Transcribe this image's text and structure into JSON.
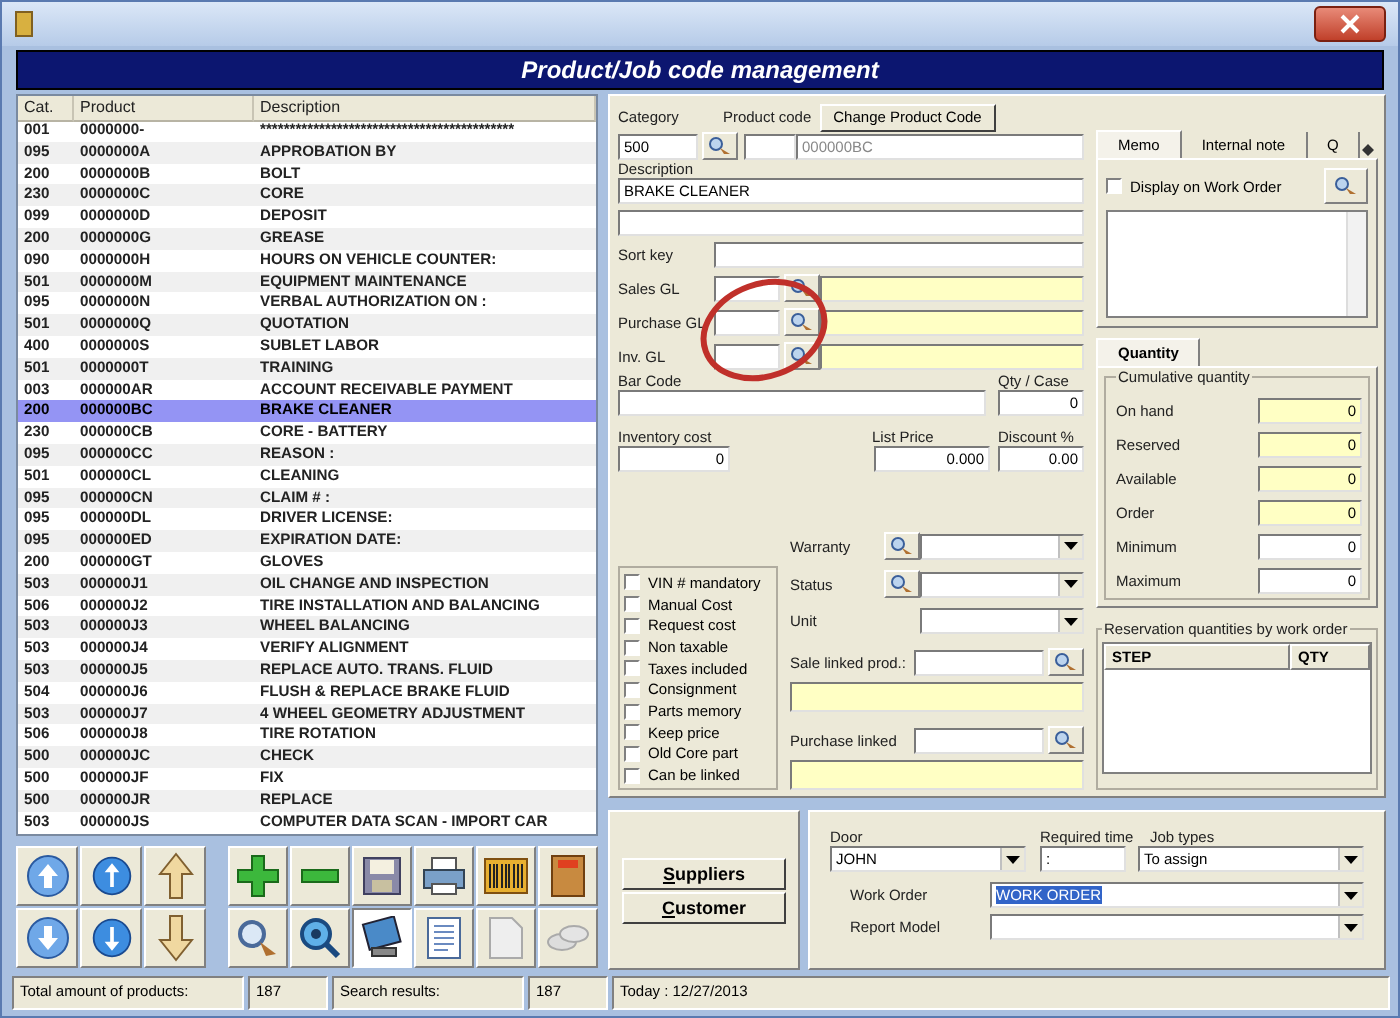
{
  "window": {
    "title": "Product/Job code management"
  },
  "products": {
    "columns": [
      "Cat.",
      "Product",
      "Description"
    ],
    "rows": [
      {
        "cat": "001",
        "product": "0000000-",
        "description": "*******************************************",
        "selected": false
      },
      {
        "cat": "095",
        "product": "0000000A",
        "description": "APPROBATION BY",
        "selected": false
      },
      {
        "cat": "200",
        "product": "0000000B",
        "description": "BOLT",
        "selected": false
      },
      {
        "cat": "230",
        "product": "0000000C",
        "description": "CORE",
        "selected": false
      },
      {
        "cat": "099",
        "product": "0000000D",
        "description": "DEPOSIT",
        "selected": false
      },
      {
        "cat": "200",
        "product": "0000000G",
        "description": "GREASE",
        "selected": false
      },
      {
        "cat": "090",
        "product": "0000000H",
        "description": "HOURS ON VEHICLE COUNTER:",
        "selected": false
      },
      {
        "cat": "501",
        "product": "0000000M",
        "description": "EQUIPMENT MAINTENANCE",
        "selected": false
      },
      {
        "cat": "095",
        "product": "0000000N",
        "description": "VERBAL AUTHORIZATION ON :",
        "selected": false
      },
      {
        "cat": "501",
        "product": "0000000Q",
        "description": "QUOTATION",
        "selected": false
      },
      {
        "cat": "400",
        "product": "0000000S",
        "description": "SUBLET LABOR",
        "selected": false
      },
      {
        "cat": "501",
        "product": "0000000T",
        "description": "TRAINING",
        "selected": false
      },
      {
        "cat": "003",
        "product": "000000AR",
        "description": "ACCOUNT RECEIVABLE PAYMENT",
        "selected": false
      },
      {
        "cat": "200",
        "product": "000000BC",
        "description": "BRAKE CLEANER",
        "selected": true
      },
      {
        "cat": "230",
        "product": "000000CB",
        "description": "CORE - BATTERY",
        "selected": false
      },
      {
        "cat": "095",
        "product": "000000CC",
        "description": "REASON :",
        "selected": false
      },
      {
        "cat": "501",
        "product": "000000CL",
        "description": "CLEANING",
        "selected": false
      },
      {
        "cat": "095",
        "product": "000000CN",
        "description": "CLAIM # :",
        "selected": false
      },
      {
        "cat": "095",
        "product": "000000DL",
        "description": "DRIVER LICENSE:",
        "selected": false
      },
      {
        "cat": "095",
        "product": "000000ED",
        "description": "EXPIRATION DATE:",
        "selected": false
      },
      {
        "cat": "200",
        "product": "000000GT",
        "description": "GLOVES",
        "selected": false
      },
      {
        "cat": "503",
        "product": "000000J1",
        "description": "OIL CHANGE AND INSPECTION",
        "selected": false
      },
      {
        "cat": "506",
        "product": "000000J2",
        "description": "TIRE INSTALLATION AND BALANCING",
        "selected": false
      },
      {
        "cat": "503",
        "product": "000000J3",
        "description": "WHEEL BALANCING",
        "selected": false
      },
      {
        "cat": "503",
        "product": "000000J4",
        "description": "VERIFY ALIGNMENT",
        "selected": false
      },
      {
        "cat": "503",
        "product": "000000J5",
        "description": "REPLACE AUTO. TRANS. FLUID",
        "selected": false
      },
      {
        "cat": "504",
        "product": "000000J6",
        "description": "FLUSH & REPLACE BRAKE FLUID",
        "selected": false
      },
      {
        "cat": "503",
        "product": "000000J7",
        "description": "4 WHEEL GEOMETRY ADJUSTMENT",
        "selected": false
      },
      {
        "cat": "506",
        "product": "000000J8",
        "description": "TIRE ROTATION",
        "selected": false
      },
      {
        "cat": "500",
        "product": "000000JC",
        "description": "CHECK",
        "selected": false
      },
      {
        "cat": "500",
        "product": "000000JF",
        "description": "FIX",
        "selected": false
      },
      {
        "cat": "500",
        "product": "000000JR",
        "description": "REPLACE",
        "selected": false
      },
      {
        "cat": "503",
        "product": "000000JS",
        "description": "COMPUTER DATA SCAN - IMPORT CAR",
        "selected": false
      }
    ]
  },
  "form": {
    "category_label": "Category",
    "category": "500",
    "product_code_label": "Product code",
    "product_code": "000000BC",
    "change_button": "Change Product Code",
    "description_label": "Description",
    "description": "BRAKE CLEANER",
    "sort_key_label": "Sort key",
    "gl": [
      {
        "label": "Sales GL"
      },
      {
        "label": "Purchase GL"
      },
      {
        "label": "Inv. GL"
      }
    ],
    "bar_code_label": "Bar Code",
    "qty_case_label": "Qty / Case",
    "qty_case": "0",
    "inventory_cost_label": "Inventory cost",
    "inventory_cost": "0",
    "list_price_label": "List Price",
    "list_price": "0.000",
    "discount_label": "Discount %",
    "discount": "0.00",
    "options": [
      {
        "label": "VIN # mandatory",
        "checked": false
      },
      {
        "label": "Manual Cost",
        "checked": false
      },
      {
        "label": "Request cost",
        "checked": false
      },
      {
        "label": "Non taxable",
        "checked": false
      },
      {
        "label": "Taxes included",
        "checked": false
      },
      {
        "label": "Consignment",
        "checked": false
      },
      {
        "label": "Parts memory",
        "checked": false
      },
      {
        "label": "Keep price",
        "checked": false
      },
      {
        "label": "Old Core part",
        "checked": false
      },
      {
        "label": "Can be linked",
        "checked": false
      }
    ],
    "selects": [
      {
        "label": "Warranty",
        "lookup": true
      },
      {
        "label": "Status",
        "lookup": true
      },
      {
        "label": "Unit",
        "lookup": false
      }
    ],
    "linked": [
      {
        "label": "Sale linked prod.:"
      },
      {
        "label": "Purchase linked"
      }
    ]
  },
  "memo": {
    "tabs": [
      {
        "label": "Memo",
        "selected": true
      },
      {
        "label": "Internal note",
        "selected": false
      },
      {
        "label": "Q",
        "selected": false
      }
    ],
    "display_on_work_order": {
      "label": "Display on Work Order",
      "checked": false
    }
  },
  "quantity": {
    "tab": {
      "label": "Quantity",
      "selected": true
    },
    "group_title": "Cumulative quantity",
    "rows": [
      {
        "label": "On hand",
        "value": "0",
        "readonly": true
      },
      {
        "label": "Reserved",
        "value": "0",
        "readonly": true
      },
      {
        "label": "Available",
        "value": "0",
        "readonly": true
      },
      {
        "label": "Order",
        "value": "0",
        "readonly": true
      },
      {
        "label": "Minimum",
        "value": "0",
        "readonly": false
      },
      {
        "label": "Maximum",
        "value": "0",
        "readonly": false
      }
    ],
    "reservation_title": "Reservation quantities by work order",
    "reservation_columns": [
      "STEP",
      "QTY"
    ]
  },
  "bottom": {
    "buttons": [
      "Suppliers",
      "Customer"
    ],
    "door_label": "Door",
    "door": "JOHN",
    "required_time_label": "Required time",
    "required_time": ":",
    "job_types_label": "Job types",
    "job_types": "To assign",
    "work_order_label": "Work Order",
    "work_order": "WORK ORDER",
    "work_order_text_selected": true,
    "report_model_label": "Report Model"
  },
  "status_bar": {
    "total_label": "Total amount of products:",
    "total": "187",
    "search_label": "Search results:",
    "search": "187",
    "today": "Today : 12/27/2013"
  }
}
